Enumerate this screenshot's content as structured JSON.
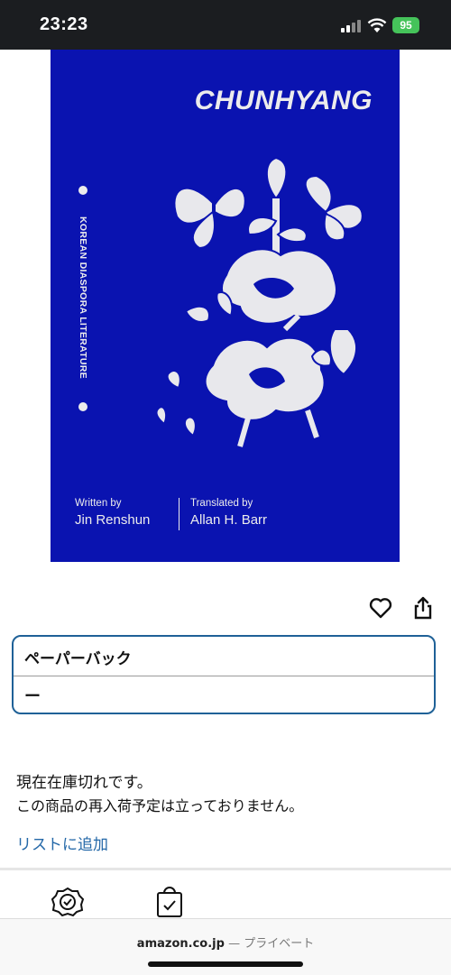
{
  "status_bar": {
    "time": "23:23",
    "battery": "95"
  },
  "book": {
    "title": "CHUNHYANG",
    "series": "KOREAN DIASPORA LITERATURE",
    "written_by_label": "Written by",
    "author": "Jin Renshun",
    "translated_by_label": "Translated by",
    "translator": "Allan H. Barr",
    "cover_color": "#0a13b0"
  },
  "actions": {
    "wishlist_icon": "heart-icon",
    "share_icon": "share-icon"
  },
  "format": {
    "label": "ペーパーバック",
    "price": "ー"
  },
  "stock": {
    "status": "現在在庫切れです。",
    "note": "この商品の再入荷予定は立っておりません。"
  },
  "add_to_list": "リストに追加",
  "feature_icons": [
    "badge-check-icon",
    "shopping-bag-check-icon"
  ],
  "browser": {
    "domain": "amazon.co.jp",
    "mode": "— プライベート"
  }
}
